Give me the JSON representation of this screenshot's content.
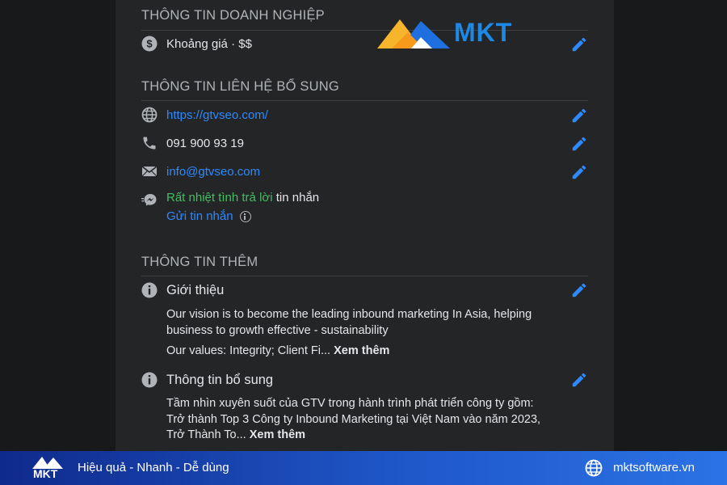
{
  "sections": {
    "business": {
      "title": "THÔNG TIN DOANH NGHIỆP",
      "price_range": "Khoảng giá · $$"
    },
    "contact": {
      "title": "THÔNG TIN LIÊN HỆ BỔ SUNG",
      "website": "https://gtvseo.com/",
      "phone": "091 900 93 19",
      "email": "info@gtvseo.com",
      "response_status": "Rất nhiệt tình trả lời",
      "response_suffix": " tin nhắn",
      "send_message": "Gửi tin nhắn"
    },
    "more": {
      "title": "THÔNG TIN THÊM",
      "intro": {
        "label": "Giới thiệu",
        "text1": "Our vision is to become the leading inbound marketing In Asia, helping business to growth effective - sustainability",
        "text2": "Our values: Integrity; Client Fi... ",
        "see_more": "Xem thêm"
      },
      "additional": {
        "label": "Thông tin bổ sung",
        "text": "Tầm nhìn xuyên suốt của GTV trong hành trình phát triển công ty gồm: Trở thành Top 3 Công ty Inbound Marketing tại Việt Nam vào năm 2023, Trở Thành To... ",
        "see_more": "Xem thêm"
      }
    }
  },
  "watermark": {
    "brand": "MKT"
  },
  "footer": {
    "brand": "MKT",
    "tagline": "Hiệu quả - Nhanh - Dễ dùng",
    "website": "mktsoftware.vn"
  },
  "colors": {
    "panel_bg": "#242526",
    "link": "#2e89ff",
    "green": "#45bd62",
    "footer_blue": "#1f57c8"
  }
}
